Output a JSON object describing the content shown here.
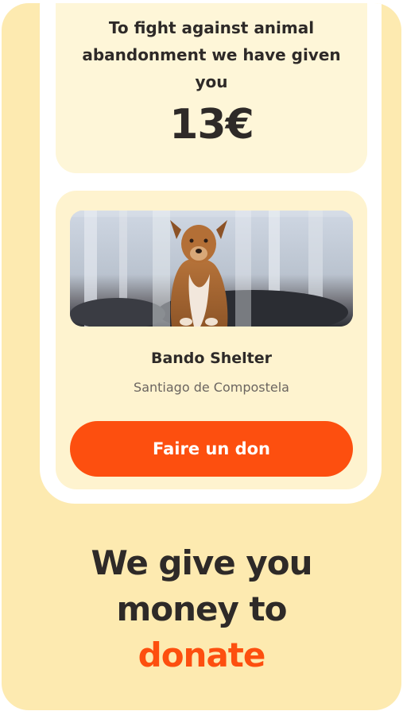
{
  "amount_card": {
    "title": "To fight against animal abandonment we have given you",
    "amount": "13€"
  },
  "shelter": {
    "name": "Bando Shelter",
    "city": "Santiago de Compostela",
    "photo_icon": "dog-photo",
    "donate_label": "Faire un don"
  },
  "headline": {
    "line1": "We give you",
    "line2": "money to",
    "accent_word": "donate"
  },
  "colors": {
    "background": "#fdeab0",
    "card": "#fef3cf",
    "accent": "#fd4f0f",
    "text": "#2e2a28"
  }
}
